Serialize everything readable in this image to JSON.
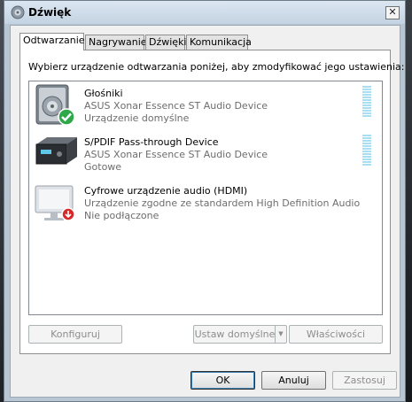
{
  "window": {
    "title": "Dźwięk",
    "close_glyph": "✕"
  },
  "tabs": [
    {
      "label": "Odtwarzanie",
      "active": true
    },
    {
      "label": "Nagrywanie",
      "active": false
    },
    {
      "label": "Dźwięki",
      "active": false
    },
    {
      "label": "Komunikacja",
      "active": false
    }
  ],
  "playback": {
    "instruction": "Wybierz urządzenie odtwarzania poniżej, aby zmodyfikować jego ustawienia:",
    "devices": [
      {
        "name": "Głośniki",
        "subtitle": "ASUS Xonar Essence ST Audio Device",
        "status": "Urządzenie domyślne",
        "icon": "speaker-icon",
        "badge": "default-check-icon",
        "level_meter": true
      },
      {
        "name": "S/PDIF Pass-through Device",
        "subtitle": "ASUS Xonar Essence ST Audio Device",
        "status": "Gotowe",
        "icon": "receiver-icon",
        "level_meter": true
      },
      {
        "name": "Cyfrowe urządzenie audio (HDMI)",
        "subtitle": "Urządzenie zgodne ze standardem High Definition Audio",
        "status": "Nie podłączone",
        "icon": "monitor-icon",
        "badge": "disconnected-icon",
        "level_meter": false
      }
    ]
  },
  "panel_buttons": {
    "configure": "Konfiguruj",
    "set_default": "Ustaw domyślne",
    "properties": "Właściwości"
  },
  "dialog_buttons": {
    "ok": "OK",
    "cancel": "Anuluj",
    "apply": "Zastosuj"
  },
  "colors": {
    "meter": "#a9dff2",
    "check_badge": "#2fa84a",
    "disconnected_badge": "#d62a2a"
  }
}
